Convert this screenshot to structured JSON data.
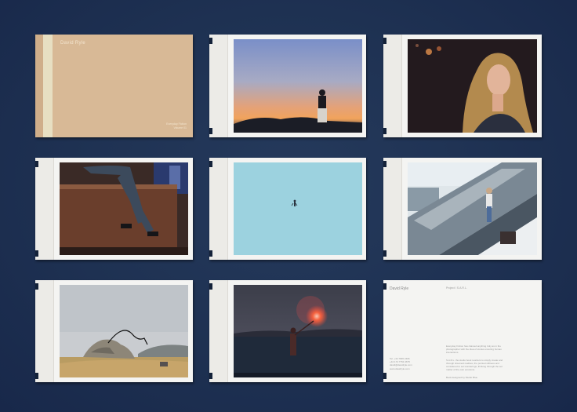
{
  "cover": {
    "name": "David Ryle",
    "subtitle_line1": "Everyday Fiction",
    "subtitle_line2": "Volume 01"
  },
  "photos": [
    {
      "name": "sunset-silhouette-photo"
    },
    {
      "name": "portrait-woman-photo"
    },
    {
      "name": "legs-on-bench-photo"
    },
    {
      "name": "figure-in-sky-photo"
    },
    {
      "name": "skater-on-roof-photo"
    },
    {
      "name": "rock-landscape-photo"
    },
    {
      "name": "flare-in-water-photo"
    }
  ],
  "back_card": {
    "name": "David Ryle",
    "project": "Project / S.A.R.L.",
    "para1": "Everyday Fiction has claimed anything truly as in the photographer with the idea of stories ensuring human interactions.",
    "para2": "S.A.R.L. the studio book reorders to simply create and through dreamed realities, the pointed stillness and considered to set wonderings, thinking through the set matter of the own emotions.",
    "contact_line1": "Tel. +44 7845 2406",
    "contact_line2": "+44 174 7754 4675",
    "contact_line3": "david@davidryle.com",
    "contact_line4": "www.davidryle.com",
    "credit": "Book designed by Studio Blue"
  }
}
